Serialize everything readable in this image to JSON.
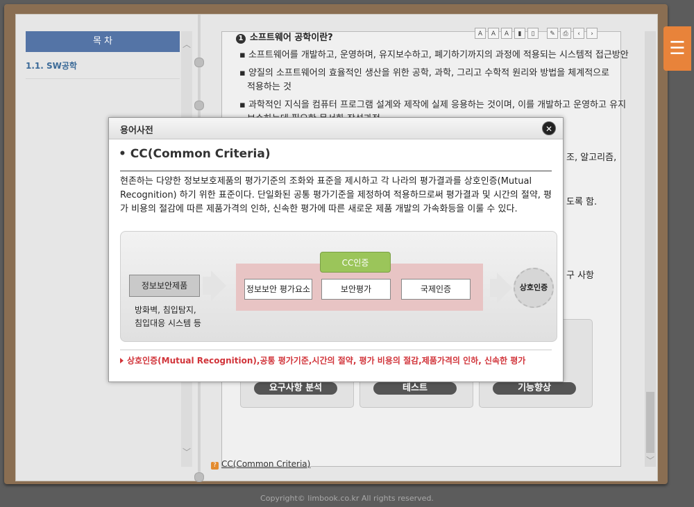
{
  "toc": {
    "header": "목 차",
    "items": [
      {
        "label": "1.1. SW공학"
      }
    ]
  },
  "toolbar": {
    "buttons": [
      "font-larger",
      "font-smaller",
      "font-reset",
      "bookmark",
      "bookmark-list",
      "memo",
      "print",
      "previous",
      "next"
    ],
    "font_larger": "A",
    "font_smaller": "A",
    "font_reset": "A",
    "prev": "‹",
    "next": "›"
  },
  "content": {
    "section_number": "1",
    "section_title": "소프트웨어 공학이란?",
    "lines": [
      "▪ 소프트웨어를 개발하고, 운영하며, 유지보수하고, 폐기하기까지의 과정에 적용되는 시스템적 접근방안",
      "▪ 양질의 소프트웨어의 효율적인 생산을 위한 공학, 과학, 그리고 수학적 원리와 방법을 체계적으로",
      "적용하는 것",
      "▪ 과학적인 지식을 컴퓨터 프로그램 설계와 제작에 실제 응용하는 것이며, 이를 개발하고 운영하고  유지",
      "보수하는데 필요한 문서화 작성과정"
    ],
    "right_fragments": [
      "조, 알고리즘,",
      "도록 함.",
      "구 사항"
    ],
    "bars": [
      "요구사항 분석",
      "테스트",
      "기능향상"
    ],
    "footer_link": "CC(Common Criteria)"
  },
  "modal": {
    "title": "용어사전",
    "close": "✕",
    "term": "• CC(Common Criteria)",
    "description": "현존하는 다양한 정보보호제품의 평가기준의 조화와 표준을 제시하고 각 나라의 평가결과를 상호인증(Mutual Recognition) 하기 위한 표준이다. 단일화된 공통 평가기준을 제정하여 적용하므로써 평가결과 및 시간의 절약, 평가 비용의 절감에 따른 제품가격의 인하, 신속한 평가에 따른 새로운 제품 개발의 가속화등을 이룰 수 있다.",
    "diagram": {
      "input": "정보보안제품",
      "input_sub_1": "방화벽, 침입탐지,",
      "input_sub_2": "침입대응 시스템 등",
      "certification": "CC인증",
      "steps": [
        "정보보안 평가요소",
        "보안평가",
        "국제인증"
      ],
      "result": "상호인증"
    },
    "keywords": "상호인증(Mutual Recognition),공통 평가기준,시간의 절약, 평가 비용의 절감,제품가격의 인하, 신속한 평가"
  },
  "copyright": "Copyright© limbook.co.kr All rights reserved."
}
